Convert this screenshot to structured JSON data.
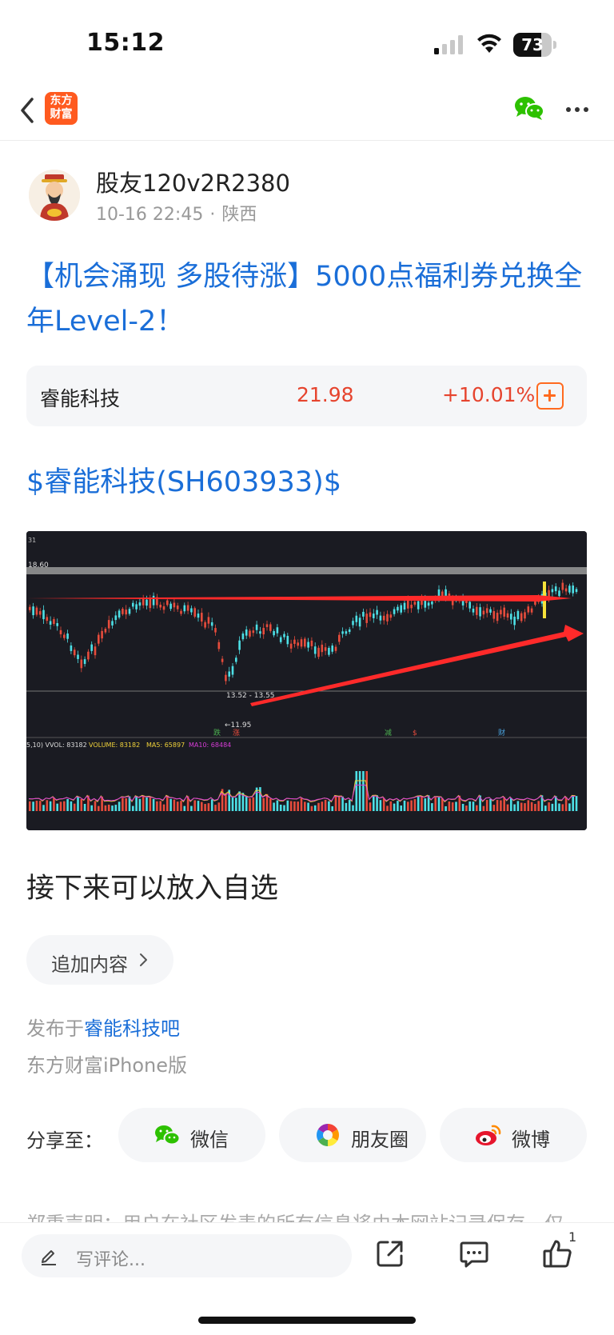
{
  "status_bar": {
    "time": "15:12",
    "battery_level": "73",
    "battery_fraction": 0.73
  },
  "nav": {
    "logo_text_line1": "东方",
    "logo_text_line2": "财富",
    "brand_color": "#ff5a1f"
  },
  "author": {
    "name": "股友120v2R2380",
    "date": "10-16 22:45",
    "separator": "·",
    "location": "陕西"
  },
  "post": {
    "title": "【机会涌现 多股待涨】5000点福利券兑换全年Level-2！",
    "stock_link": "$睿能科技(SH603933)$",
    "body": "接下来可以放入自选"
  },
  "stock_card": {
    "name": "睿能科技",
    "price": "21.98",
    "change": "+10.01%",
    "up_color": "#e6442e"
  },
  "chart_image": {
    "top_label": "31",
    "price_level": "18.60",
    "range_label": "13.52 - 13.55",
    "low_label": "←11.95",
    "marker_1": "跌",
    "marker_2": "涨",
    "marker_3": "减",
    "marker_4": "$",
    "marker_5": "财",
    "volume_label": "5,10)  VVOL: 83182",
    "volume_value": "VOLUME: 83182",
    "ma5": "MA5: 65897",
    "ma10": "MA10: 68484"
  },
  "actions": {
    "append_label": "追加内容"
  },
  "meta": {
    "published_prefix": "发布于",
    "bar_name": "睿能科技吧",
    "platform": "东方财富iPhone版"
  },
  "share": {
    "label": "分享至：",
    "wechat": "微信",
    "moments": "朋友圈",
    "weibo": "微博"
  },
  "disclaimer": "郑重声明：用户在社区发表的所有信息将由本网站记录保存，仅",
  "bottom": {
    "comment_placeholder": "写评论...",
    "like_count": "1"
  },
  "colors": {
    "link": "#1a6ed8",
    "wechat_green": "#2dc100",
    "accent_orange": "#ff6a1f"
  }
}
